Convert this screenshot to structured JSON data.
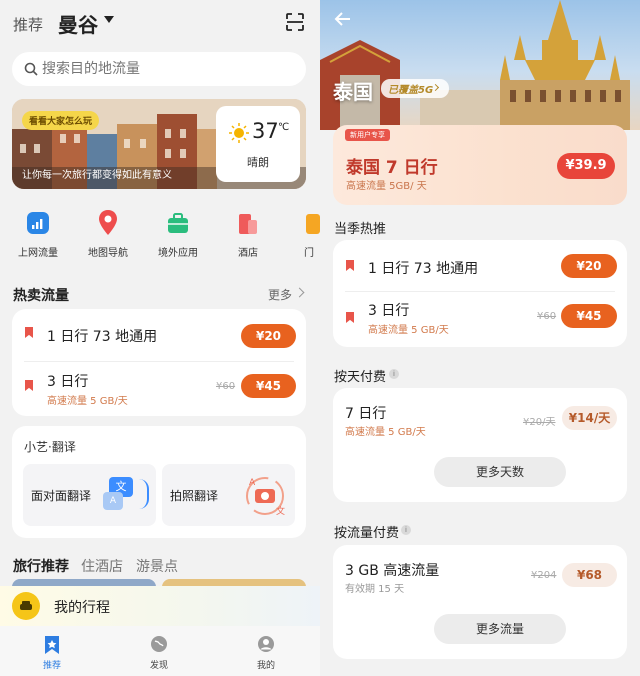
{
  "left": {
    "header": {
      "recommend": "推荐",
      "city": "曼谷"
    },
    "search": {
      "placeholder": "搜索目的地流量"
    },
    "banner": {
      "tag": "看看大家怎么玩",
      "caption": "让你每一次旅行都变得如此有意义"
    },
    "weather": {
      "temp": "37",
      "unit": "℃",
      "desc": "晴朗"
    },
    "categories": [
      {
        "label": "上网流量",
        "icon": "chart-bars-icon"
      },
      {
        "label": "地图导航",
        "icon": "map-pin-icon"
      },
      {
        "label": "境外应用",
        "icon": "suitcase-icon"
      },
      {
        "label": "酒店",
        "icon": "hotel-icon"
      },
      {
        "label": "门",
        "icon": "ticket-icon"
      }
    ],
    "hot": {
      "title": "热卖流量",
      "more": "更多",
      "items": [
        {
          "name": "1 日行  73 地通用",
          "sub": "",
          "old": "",
          "price": "¥20"
        },
        {
          "name": "3 日行",
          "sub": "高速流量 5 GB/天",
          "old": "¥60",
          "price": "¥45"
        }
      ]
    },
    "translate": {
      "title": "小艺·翻译",
      "face": "面对面翻译",
      "photo": "拍照翻译",
      "glyph_wen": "文",
      "glyph_a": "A"
    },
    "tabs": [
      "旅行推荐",
      "住酒店",
      "游景点"
    ],
    "trip": {
      "label": "我的行程"
    },
    "nav": [
      {
        "label": "推荐",
        "icon": "bookmark-star-icon",
        "active": true
      },
      {
        "label": "发现",
        "icon": "globe-icon",
        "active": false
      },
      {
        "label": "我的",
        "icon": "person-icon",
        "active": false
      }
    ]
  },
  "right": {
    "hero": {
      "country": "泰国",
      "badge": "已覆盖5G"
    },
    "new_user": {
      "tag": "新用户专享",
      "title": "泰国 7 日行",
      "sub": "高速流量 5GB/ 天",
      "price": "¥39.9"
    },
    "season": {
      "title": "当季热推",
      "items": [
        {
          "name": "1 日行  73 地通用",
          "sub": "",
          "old": "",
          "price": "¥20"
        },
        {
          "name": "3 日行",
          "sub": "高速流量 5 GB/天",
          "old": "¥60",
          "price": "¥45"
        }
      ]
    },
    "daily": {
      "title": "按天付费",
      "item": {
        "name": "7 日行",
        "sub": "高速流量 5 GB/天",
        "old": "¥20/天",
        "price": "¥14/天"
      },
      "more": "更多天数"
    },
    "traffic": {
      "title": "按流量付费",
      "item": {
        "name": "3 GB 高速流量",
        "sub": "有效期 15 天",
        "old": "¥204",
        "price": "¥68"
      },
      "more": "更多流量"
    }
  },
  "colors": {
    "accent": "#e8621f",
    "red_tag": "#e8554a",
    "blue_nav": "#2e7de1"
  }
}
